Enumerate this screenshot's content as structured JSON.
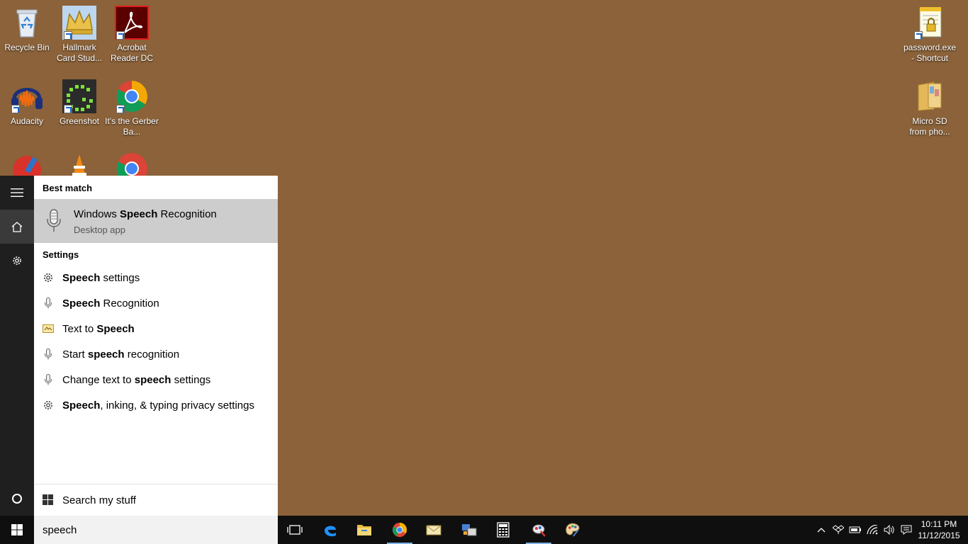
{
  "desktop": {
    "background_color": "#8B6239",
    "icons": [
      {
        "name": "recycle-bin-icon",
        "label": "Recycle Bin"
      },
      {
        "name": "hallmark-icon",
        "label": "Hallmark Card Stud..."
      },
      {
        "name": "acrobat-icon",
        "label": "Acrobat Reader DC"
      },
      {
        "name": "audacity-icon",
        "label": "Audacity"
      },
      {
        "name": "greenshot-icon",
        "label": "Greenshot"
      },
      {
        "name": "chrome-icon",
        "label": "It's the Gerber Ba..."
      },
      {
        "name": "password-file-icon",
        "label": "password.exe - Shortcut"
      },
      {
        "name": "folder-icon",
        "label": "Micro SD from pho..."
      }
    ]
  },
  "start_menu": {
    "best_match_heading": "Best match",
    "best_match": {
      "title_pre": "Windows ",
      "title_bold": "Speech",
      "title_post": " Recognition",
      "subtitle": "Desktop app"
    },
    "settings_heading": "Settings",
    "results": [
      {
        "icon": "gear-icon",
        "pre": "",
        "bold": "Speech",
        "post": " settings"
      },
      {
        "icon": "microphone-icon",
        "pre": "",
        "bold": "Speech",
        "post": " Recognition"
      },
      {
        "icon": "text-to-speech-icon",
        "pre": "Text to ",
        "bold": "Speech",
        "post": ""
      },
      {
        "icon": "microphone-icon",
        "pre": "Start ",
        "bold": "speech",
        "post": " recognition"
      },
      {
        "icon": "microphone-icon",
        "pre": "Change text to ",
        "bold": "speech",
        "post": " settings"
      },
      {
        "icon": "gear-icon",
        "pre": "",
        "bold": "Speech",
        "post": ", inking, & typing privacy settings"
      }
    ],
    "search_my_stuff": "Search my stuff"
  },
  "taskbar": {
    "search_query": "speech",
    "apps": [
      "task-view-icon",
      "edge-icon",
      "file-explorer-icon",
      "chrome-icon",
      "mail-icon",
      "control-panel-icon",
      "calculator-icon",
      "paint-app-icon",
      "palette-icon"
    ],
    "clock_time": "10:11 PM",
    "clock_date": "11/12/2015"
  }
}
